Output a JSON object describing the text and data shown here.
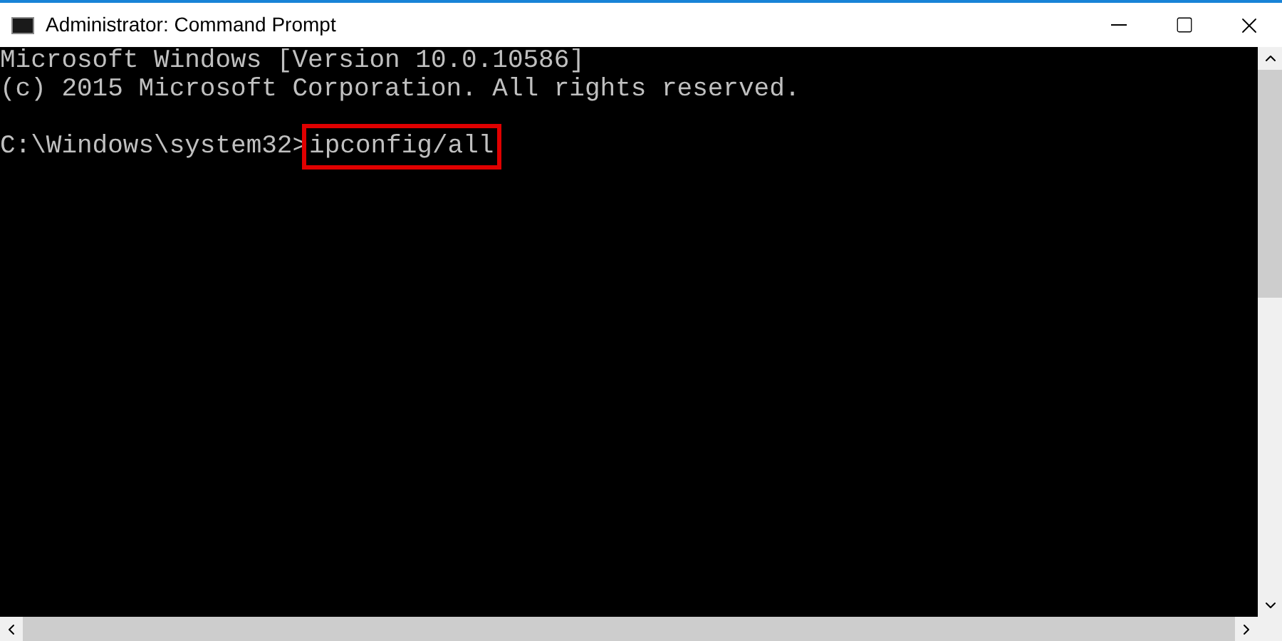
{
  "window": {
    "title": "Administrator: Command Prompt"
  },
  "console": {
    "lines": [
      {
        "text": "Microsoft Windows [Version 10.0.10586]"
      },
      {
        "text": "(c) 2015 Microsoft Corporation. All rights reserved."
      }
    ],
    "prompt": "C:\\Windows\\system32>",
    "command": {
      "text": "ipconfig/all",
      "highlighted": true
    }
  }
}
